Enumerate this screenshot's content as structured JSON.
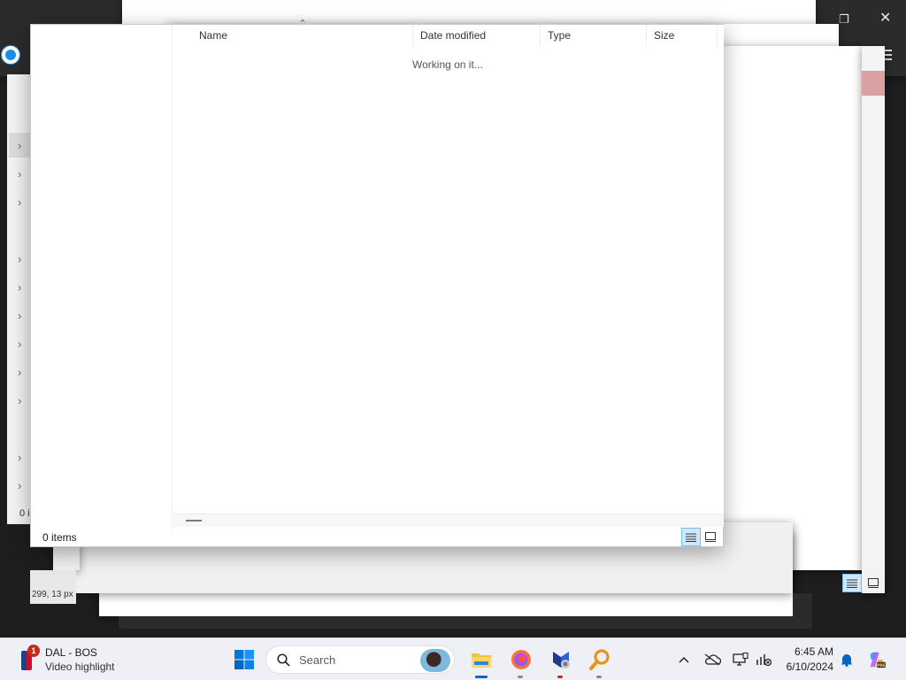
{
  "explorer": {
    "columns": [
      "Name",
      "Date modified",
      "Type",
      "Size"
    ],
    "loading_text": "Working on it...",
    "status": "0 items",
    "view_modes": [
      "details-view",
      "large-icons-view"
    ]
  },
  "background_windows": {
    "partial_status": "0 i",
    "partial_coords": "299, 13 px"
  },
  "taskbar": {
    "widget": {
      "badge_count": "1",
      "title": "DAL - BOS",
      "subtitle": "Video highlight"
    },
    "search_placeholder": "Search",
    "pinned_apps": [
      "start-icon",
      "file-explorer-icon",
      "firefox-icon",
      "snipping-tool-icon",
      "search-magnifier-app-icon"
    ],
    "tray": {
      "time": "6:45 AM",
      "date": "6/10/2024"
    },
    "accent_color": "#0067c0"
  }
}
